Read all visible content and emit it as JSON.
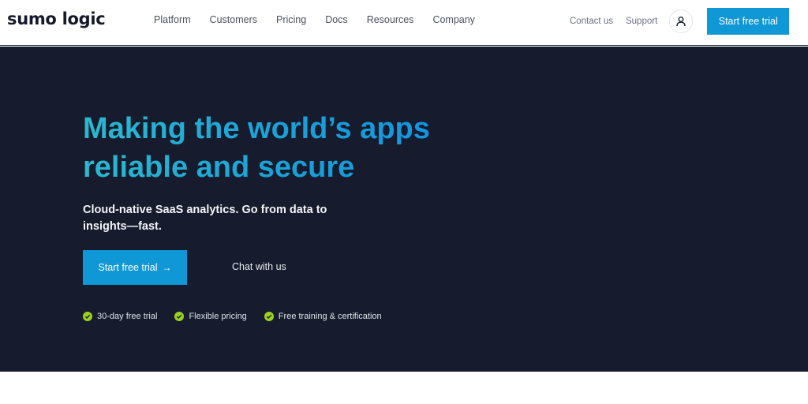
{
  "header": {
    "logo": "sumo logic",
    "nav": [
      {
        "label": "Platform"
      },
      {
        "label": "Customers"
      },
      {
        "label": "Pricing"
      },
      {
        "label": "Docs"
      },
      {
        "label": "Resources"
      },
      {
        "label": "Company"
      }
    ],
    "contact_label": "Contact us",
    "support_label": "Support",
    "account_icon": "user-icon",
    "trial_label": "Start free trial"
  },
  "hero": {
    "headline_line1": "Making the world’s apps",
    "headline_line2": "reliable and secure",
    "subheading": "Cloud-native SaaS analytics. Go from data to insights—fast.",
    "primary_cta": "Start free trial",
    "primary_cta_icon": "arrow-right-icon",
    "secondary_cta": "Chat with us",
    "features": [
      {
        "label": "30-day free trial",
        "icon": "check-circle-icon"
      },
      {
        "label": "Flexible pricing",
        "icon": "check-circle-icon"
      },
      {
        "label": "Free training & certification",
        "icon": "check-circle-icon"
      }
    ]
  },
  "colors": {
    "brand_blue": "#0f97d6",
    "hero_background": "#161c2d",
    "check_green": "#9bd11f",
    "headline_teal": "#16a3d3"
  }
}
